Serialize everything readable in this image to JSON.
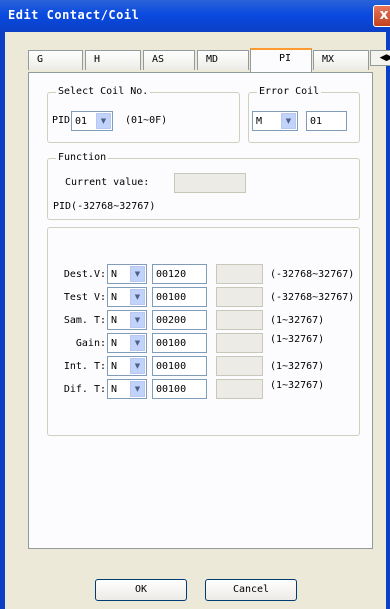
{
  "window": {
    "title": "Edit Contact/Coil",
    "close_symbol": "x"
  },
  "tabs": [
    {
      "label": "G"
    },
    {
      "label": "H"
    },
    {
      "label": "AS"
    },
    {
      "label": "MD"
    },
    {
      "label": "PI"
    },
    {
      "label": "MX"
    }
  ],
  "tab_scroll": {
    "left": "◀",
    "right": "▶"
  },
  "select_coil": {
    "legend": "Select Coil No.",
    "prefix": "PID",
    "value": "01",
    "range": "(01~0F)"
  },
  "error_coil": {
    "legend": "Error Coil",
    "type_value": "M",
    "number_value": "01"
  },
  "function": {
    "legend": "Function",
    "current_value_label": "Current value:",
    "current_value": "",
    "range_note": "PID(-32768~32767)"
  },
  "params": [
    {
      "label": "Dest.V:",
      "type": "N",
      "value": "00120",
      "readout": "",
      "range": "(-32768~32767)"
    },
    {
      "label": "Test V:",
      "type": "N",
      "value": "00100",
      "readout": "",
      "range": "(-32768~32767)"
    },
    {
      "label": "Sam. T:",
      "type": "N",
      "value": "00200",
      "readout": "",
      "range": "(1~32767)"
    },
    {
      "label": "Gain:",
      "type": "N",
      "value": "00100",
      "readout": "",
      "range": "(1~32767)"
    },
    {
      "label": "Int. T:",
      "type": "N",
      "value": "00100",
      "readout": "",
      "range": "(1~32767)"
    },
    {
      "label": "Dif. T:",
      "type": "N",
      "value": "00100",
      "readout": "",
      "range": "(1~32767)"
    }
  ],
  "buttons": {
    "ok": "OK",
    "cancel": "Cancel"
  },
  "colors": {
    "titlebar": "#0b3fc6",
    "active_tab_accent": "#ff9a2e",
    "dialog_bg": "#ece9d8"
  }
}
